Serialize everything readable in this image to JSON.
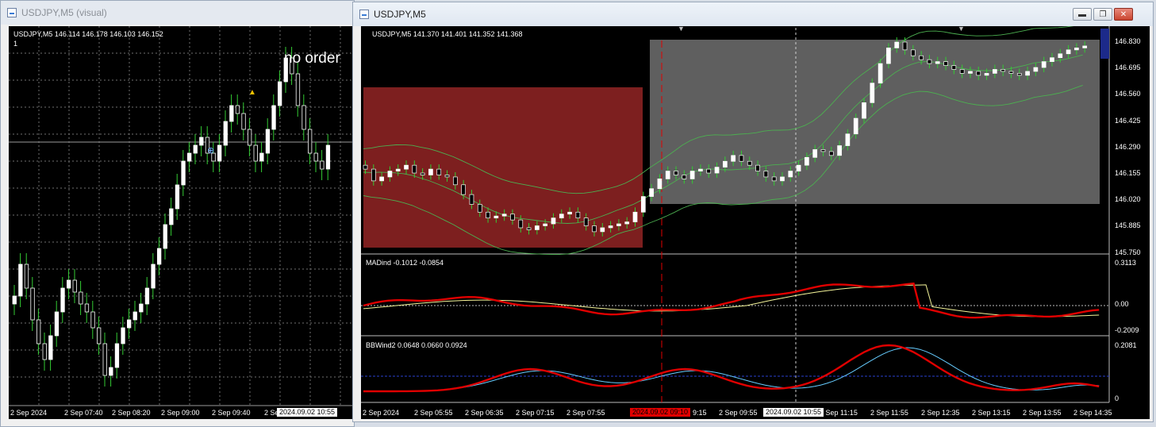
{
  "left_window": {
    "title": "USDJPY,M5 (visual)",
    "info": "USDJPY,M5  146.114 146.178 146.103 146.152",
    "sub_label": "1",
    "overlay_text": "no order",
    "time_labels": [
      "2 Sep 2024",
      "2 Sep 07:40",
      "2 Sep 08:20",
      "2 Sep 09:00",
      "2 Sep 09:40",
      "2 Se"
    ],
    "cursor_time": "2024.09.02 10:55"
  },
  "right_window": {
    "title": "USDJPY,M5",
    "controls": {
      "minimize": "▬",
      "maximize": "❐",
      "close": "✕"
    },
    "main": {
      "info": "USDJPY,M5  141.370 141.401 141.352 141.368",
      "price_labels": [
        "146.830",
        "146.695",
        "146.560",
        "146.425",
        "146.290",
        "146.155",
        "146.020",
        "145.885",
        "145.750"
      ]
    },
    "mad": {
      "info": "MADind -0.1012 -0.0854",
      "scale_labels": [
        "0.3113",
        "0.00",
        "-0.2009"
      ]
    },
    "bbw": {
      "info": "BBWind2 0.0648 0.0660 0.0924",
      "scale_labels": [
        "0.2081",
        "0"
      ]
    },
    "time_labels": [
      "2 Sep 2024",
      "2 Sep 05:55",
      "2 Sep 06:35",
      "2 Sep 07:15",
      "2 Sep 07:55",
      "9:15",
      "2 Sep 09:55",
      "2 Sep 11:15",
      "2 Sep 11:55",
      "2 Sep 12:35",
      "2 Sep 13:15",
      "2 Sep 13:55",
      "2 Sep 14:35"
    ],
    "marker_time_red": "2024.09.02 09:10",
    "marker_time_white": "2024.09.02 10:55"
  },
  "colors": {
    "bull": "#ffffff",
    "wick": "#33cc33",
    "band": "#4caf50",
    "red_zone": "#7d1f1f",
    "gray_zone": "#5f5f5f",
    "mad_fast": "#e00000",
    "mad_slow": "#f5f59a",
    "bbw_line": "#e00000",
    "bbw_slow": "#66ccff"
  }
}
